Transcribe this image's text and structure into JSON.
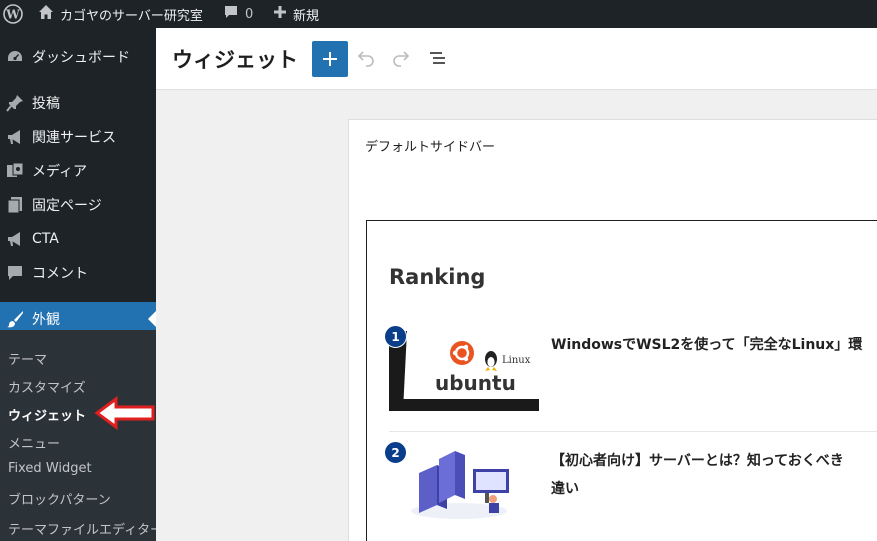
{
  "admin_bar": {
    "site_name": "カゴヤのサーバー研究室",
    "comment_count": "0",
    "new_label": "新規"
  },
  "sidebar": {
    "dashboard": "ダッシュボード",
    "items": [
      {
        "label": "投稿",
        "icon": "pin-icon"
      },
      {
        "label": "関連サービス",
        "icon": "megaphone-icon"
      },
      {
        "label": "メディア",
        "icon": "media-icon"
      },
      {
        "label": "固定ページ",
        "icon": "page-icon"
      },
      {
        "label": "CTA",
        "icon": "megaphone-icon"
      },
      {
        "label": "コメント",
        "icon": "comment-icon"
      }
    ],
    "active": {
      "label": "外観",
      "icon": "brush-icon"
    },
    "submenu": [
      "テーマ",
      "カスタマイズ",
      "ウィジェット",
      "メニュー",
      "Fixed Widget",
      "ブロックパターン",
      "テーマファイルエディター"
    ],
    "current_submenu": "ウィジェット"
  },
  "header": {
    "title": "ウィジェット"
  },
  "widget_area": {
    "title": "デフォルトサイドバー",
    "block_heading": "Ranking",
    "items": [
      {
        "rank": "1",
        "title": "WindowsでWSL2を使って「完全なLinux」環",
        "thumb_text": "ubuntu",
        "thumb_sub": "Linux"
      },
      {
        "rank": "2",
        "title": "【初心者向け】サーバーとは？知っておくべき",
        "title_line2": "違い"
      }
    ]
  },
  "colors": {
    "admin_dark": "#1d2327",
    "accent": "#2271b1",
    "badge": "#0a3d8a",
    "arrow": "#e02020"
  }
}
